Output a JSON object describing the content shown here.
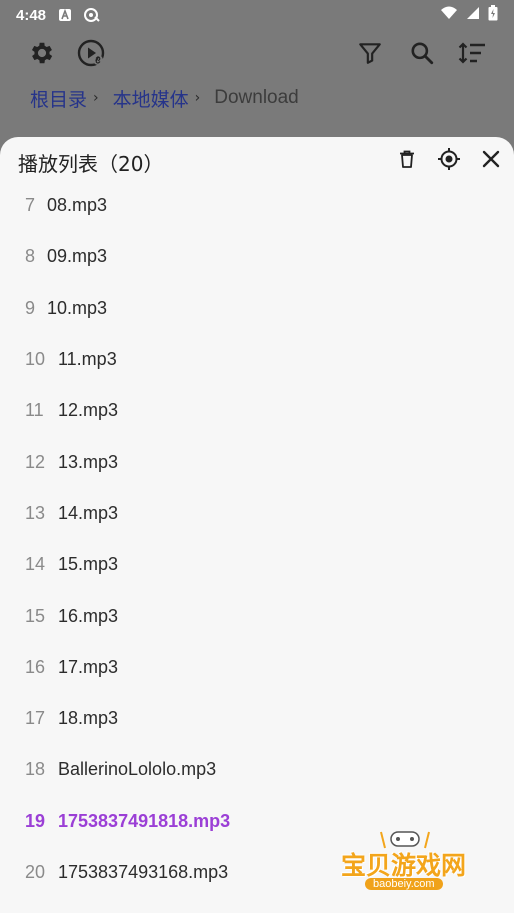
{
  "status_bar": {
    "time": "4:48"
  },
  "breadcrumb": {
    "items": [
      "根目录",
      "本地媒体"
    ],
    "separator": "›",
    "current": "Download"
  },
  "playlist_sheet": {
    "title": "播放列表（20）",
    "items": [
      {
        "num": "7",
        "name": "08.mp3"
      },
      {
        "num": "8",
        "name": "09.mp3"
      },
      {
        "num": "9",
        "name": "10.mp3"
      },
      {
        "num": "10",
        "name": "11.mp3"
      },
      {
        "num": "11",
        "name": "12.mp3"
      },
      {
        "num": "12",
        "name": "13.mp3"
      },
      {
        "num": "13",
        "name": "14.mp3"
      },
      {
        "num": "14",
        "name": "15.mp3"
      },
      {
        "num": "15",
        "name": "16.mp3"
      },
      {
        "num": "16",
        "name": "17.mp3"
      },
      {
        "num": "17",
        "name": "18.mp3"
      },
      {
        "num": "18",
        "name": "BallerinoLololo.mp3"
      },
      {
        "num": "19",
        "name": "1753837491818.mp3",
        "active": true
      },
      {
        "num": "20",
        "name": "1753837493168.mp3"
      }
    ]
  },
  "watermark": {
    "name": "宝贝游戏网",
    "url": "baobeiy.com"
  },
  "colors": {
    "accent": "#9b3fd6",
    "breadcrumb_link": "#26348a",
    "scrim": "#7a7a7a",
    "sheet_bg": "#f7f7f7"
  },
  "icons": {
    "toolbar": [
      "gear-icon",
      "play-circle-icon",
      "filter-icon",
      "search-icon",
      "sort-icon"
    ],
    "sheet_header": [
      "delete-icon",
      "locate-icon",
      "close-icon"
    ]
  }
}
